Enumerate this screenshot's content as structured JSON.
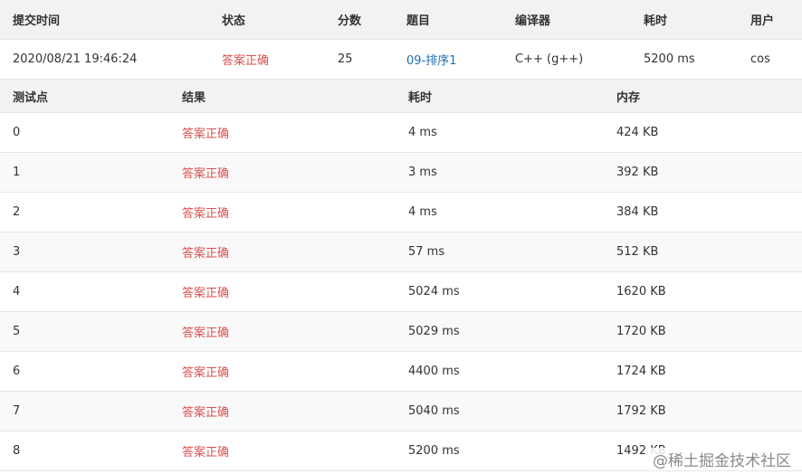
{
  "summary": {
    "headers": {
      "submit_time": "提交时间",
      "status": "状态",
      "score": "分数",
      "problem": "题目",
      "compiler": "编译器",
      "time": "耗时",
      "user": "用户"
    },
    "row": {
      "submit_time": "2020/08/21 19:46:24",
      "status": "答案正确",
      "score": "25",
      "problem": "09-排序1",
      "compiler": "C++ (g++)",
      "time": "5200 ms",
      "user": "cos"
    }
  },
  "tests": {
    "headers": {
      "case": "测试点",
      "result": "结果",
      "time": "耗时",
      "memory": "内存"
    },
    "rows": [
      {
        "case": "0",
        "result": "答案正确",
        "time": "4 ms",
        "memory": "424 KB"
      },
      {
        "case": "1",
        "result": "答案正确",
        "time": "3 ms",
        "memory": "392 KB"
      },
      {
        "case": "2",
        "result": "答案正确",
        "time": "4 ms",
        "memory": "384 KB"
      },
      {
        "case": "3",
        "result": "答案正确",
        "time": "57 ms",
        "memory": "512 KB"
      },
      {
        "case": "4",
        "result": "答案正确",
        "time": "5024 ms",
        "memory": "1620 KB"
      },
      {
        "case": "5",
        "result": "答案正确",
        "time": "5029 ms",
        "memory": "1720 KB"
      },
      {
        "case": "6",
        "result": "答案正确",
        "time": "4400 ms",
        "memory": "1724 KB"
      },
      {
        "case": "7",
        "result": "答案正确",
        "time": "5040 ms",
        "memory": "1792 KB"
      },
      {
        "case": "8",
        "result": "答案正确",
        "time": "5200 ms",
        "memory": "1492 KB"
      }
    ]
  },
  "watermark": {
    "text": "@稀土掘金技术社区"
  },
  "colors": {
    "accepted": "#d9534f",
    "link": "#1f6fb2",
    "header_bg": "#f2f2f2"
  }
}
